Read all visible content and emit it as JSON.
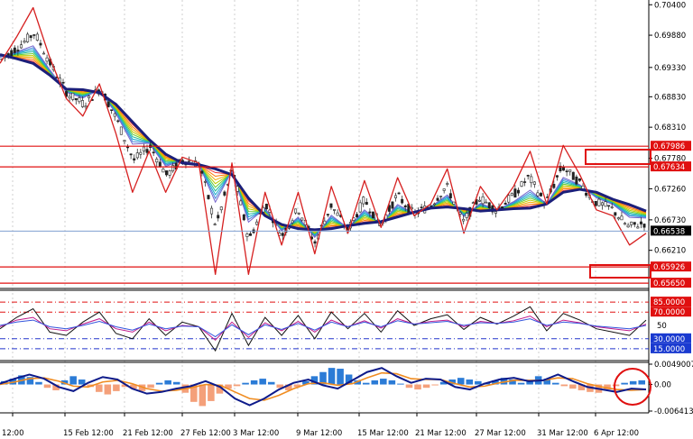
{
  "chart_data": [
    {
      "type": "line",
      "panel": "price",
      "y_ticks": [
        "0.70400",
        "0.69880",
        "0.69330",
        "0.68830",
        "0.68310",
        "0.67780",
        "0.67260",
        "0.66730",
        "0.66210"
      ],
      "ylim": [
        0.6559,
        0.7045
      ],
      "current_price": "0.66538",
      "levels": [
        {
          "label": "0.67986",
          "value": 0.67986
        },
        {
          "label": "0.67634",
          "value": 0.67634
        },
        {
          "label": "0.65926",
          "value": 0.65926
        },
        {
          "label": "0.65650",
          "value": 0.6565
        }
      ],
      "series": [
        {
          "name": "",
          "color": "#1b1f7a",
          "y": [
            0.6955,
            0.6948,
            0.694,
            0.692,
            0.6896,
            0.6895,
            0.689,
            0.687,
            0.684,
            0.681,
            0.6785,
            0.677,
            0.6767,
            0.676,
            0.675,
            0.671,
            0.668,
            0.6665,
            0.6658,
            0.6656,
            0.6658,
            0.6663,
            0.6667,
            0.667,
            0.6678,
            0.6686,
            0.6693,
            0.6695,
            0.6692,
            0.6688,
            0.669,
            0.6692,
            0.6693,
            0.67,
            0.672,
            0.6725,
            0.672,
            0.6708,
            0.6699,
            0.6688
          ]
        },
        {
          "name": "",
          "color": "#d62020",
          "y": [
            0.694,
            0.6985,
            0.7035,
            0.695,
            0.688,
            0.685,
            0.6905,
            0.682,
            0.672,
            0.679,
            0.672,
            0.678,
            0.677,
            0.658,
            0.677,
            0.658,
            0.672,
            0.663,
            0.672,
            0.6615,
            0.673,
            0.665,
            0.674,
            0.666,
            0.6745,
            0.668,
            0.67,
            0.676,
            0.665,
            0.673,
            0.669,
            0.673,
            0.679,
            0.67,
            0.68,
            0.675,
            0.669,
            0.668,
            0.663,
            0.665
          ]
        }
      ]
    },
    {
      "type": "line",
      "panel": "rsi",
      "y_ticks": [
        "85.0000",
        "70.0000",
        "50",
        "30.0000",
        "15.0000"
      ],
      "levels": [
        {
          "label": "85.0000",
          "value": 85
        },
        {
          "label": "70.0000",
          "value": 70
        },
        {
          "label": "30.0000",
          "value": 30
        },
        {
          "label": "15.0000",
          "value": 15
        }
      ],
      "ylim": [
        0,
        100
      ],
      "series": [
        {
          "name": "",
          "color": "#111111",
          "y": [
            45,
            62,
            75,
            40,
            35,
            55,
            70,
            38,
            30,
            60,
            35,
            55,
            48,
            12,
            68,
            20,
            62,
            35,
            65,
            30,
            70,
            45,
            68,
            40,
            72,
            50,
            60,
            66,
            44,
            62,
            52,
            64,
            78,
            42,
            68,
            58,
            45,
            40,
            35,
            58
          ]
        },
        {
          "name": "",
          "color": "#c01a8a",
          "y": [
            48,
            58,
            62,
            45,
            42,
            52,
            60,
            45,
            40,
            55,
            42,
            50,
            48,
            28,
            55,
            32,
            54,
            42,
            56,
            40,
            58,
            48,
            57,
            46,
            60,
            52,
            56,
            58,
            48,
            56,
            53,
            57,
            64,
            48,
            58,
            54,
            48,
            45,
            42,
            52
          ]
        },
        {
          "name": "",
          "color": "#3355dd",
          "y": [
            50,
            55,
            58,
            48,
            45,
            50,
            56,
            48,
            43,
            52,
            45,
            49,
            48,
            33,
            51,
            36,
            51,
            44,
            53,
            43,
            55,
            48,
            55,
            48,
            57,
            52,
            54,
            56,
            50,
            54,
            53,
            55,
            60,
            50,
            55,
            53,
            49,
            47,
            45,
            50
          ]
        }
      ]
    },
    {
      "type": "bar",
      "panel": "macd",
      "y_ticks": [
        "0.0049007",
        "0.00",
        "-0.0064135"
      ],
      "ylim": [
        -0.0064135,
        0.0049007
      ],
      "colors": {
        "positive": "#2b7bd6",
        "negative": "#f4a07a",
        "signal": "#f08c20",
        "main": "#0d1a8a"
      },
      "values": [
        0.0008,
        0.0014,
        0.0022,
        0.0018,
        0.0006,
        -0.0008,
        -0.0014,
        0.001,
        0.002,
        0.0012,
        -0.0006,
        -0.0018,
        -0.0024,
        -0.0016,
        -0.0006,
        -0.001,
        -0.0016,
        -0.0008,
        0.0004,
        0.001,
        0.0006,
        -0.002,
        -0.0042,
        -0.0052,
        -0.004,
        -0.0022,
        -0.001,
        -0.0004,
        0.0004,
        0.001,
        0.0014,
        0.0006,
        -0.0008,
        -0.0014,
        -0.0006,
        0.0008,
        0.002,
        0.003,
        0.004,
        0.0038,
        0.0024,
        0.001,
        0.0004,
        0.001,
        0.0014,
        0.001,
        0.0002,
        -0.0008,
        -0.0012,
        -0.0008,
        -0.0002,
        0.0006,
        0.0012,
        0.0016,
        0.0012,
        0.0008,
        0.0004,
        0.001,
        0.0016,
        0.0012,
        0.0004,
        0.001,
        0.002,
        0.0014,
        0.0004,
        -0.0004,
        -0.001,
        -0.0014,
        -0.0018,
        -0.002,
        -0.0012,
        -0.0004,
        0.0004,
        0.0008,
        0.001
      ],
      "series": [
        {
          "name": "",
          "color": "#0d1a8a",
          "y": [
            0.0002,
            0.0014,
            0.0024,
            0.0014,
            -0.0006,
            -0.0016,
            0.0004,
            0.0018,
            0.0012,
            -0.001,
            -0.0022,
            -0.0018,
            -0.001,
            -0.0004,
            0.0008,
            -0.0006,
            -0.0034,
            -0.005,
            -0.0034,
            -0.0012,
            0.0004,
            0.0012,
            -0.0002,
            -0.001,
            0.001,
            0.003,
            0.004,
            0.002,
            0.0004,
            0.0014,
            0.0012,
            -0.0006,
            -0.0012,
            0.0002,
            0.0012,
            0.0016,
            0.0008,
            0.001,
            0.0024,
            0.0008,
            -0.0006,
            -0.0012,
            -0.0018,
            -0.001,
            -0.0012
          ]
        },
        {
          "name": "",
          "color": "#f08c20",
          "y": [
            0.0,
            0.0006,
            0.0014,
            0.0016,
            0.0008,
            -0.0004,
            -0.0006,
            0.0006,
            0.001,
            0.0002,
            -0.001,
            -0.0016,
            -0.0014,
            -0.0008,
            0.0,
            -0.0002,
            -0.0018,
            -0.0034,
            -0.0038,
            -0.0026,
            -0.001,
            0.0002,
            0.0004,
            -0.0002,
            0.0002,
            0.0016,
            0.0028,
            0.0026,
            0.0014,
            0.0012,
            0.0012,
            0.0002,
            -0.0006,
            -0.0004,
            0.0004,
            0.001,
            0.001,
            0.001,
            0.0016,
            0.0014,
            0.0002,
            -0.0006,
            -0.0012,
            -0.0014,
            -0.0012
          ]
        }
      ]
    }
  ],
  "x_ticks": [
    "12:00",
    "15 Feb 12:00",
    "21 Feb 12:00",
    "27 Feb 12:00",
    "3 Mar 12:00",
    "9 Mar 12:00",
    "15 Mar 12:00",
    "21 Mar 12:00",
    "27 Mar 12:00",
    "31 Mar 12:00",
    "6 Apr 12:00"
  ]
}
